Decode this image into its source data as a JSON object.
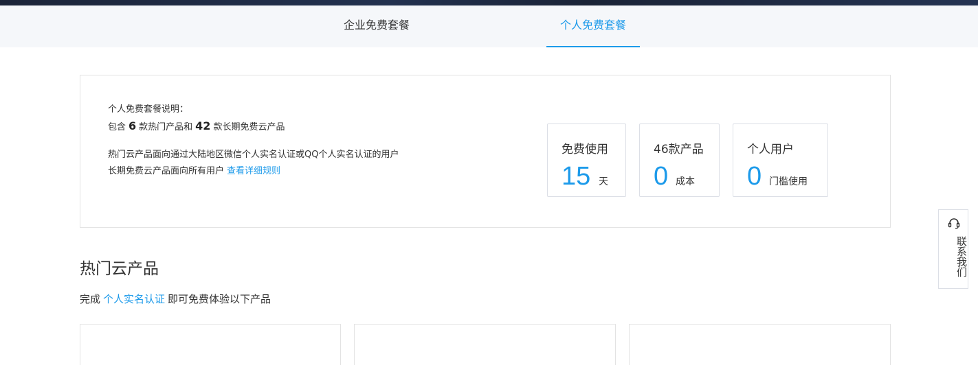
{
  "tabs": [
    {
      "label": "企业免费套餐",
      "active": false
    },
    {
      "label": "个人免费套餐",
      "active": true
    }
  ],
  "info": {
    "title": "个人免费套餐说明：",
    "include_prefix": "包含",
    "hot_count": "6",
    "include_mid": "款热门产品和",
    "long_count": "42",
    "include_suffix": "款长期免费云产品",
    "hot_desc": "热门云产品面向通过大陆地区微信个人实名认证或QQ个人实名认证的用户",
    "long_desc": "长期免费云产品面向所有用户",
    "rules_link": "查看详细规则"
  },
  "stats": [
    {
      "title": "免费使用",
      "value": "15",
      "unit": "天"
    },
    {
      "title": "46款产品",
      "value": "0",
      "unit": "成本"
    },
    {
      "title": "个人用户",
      "value": "0",
      "unit": "门槛使用"
    }
  ],
  "section": {
    "title": "热门云产品",
    "sub_prefix": "完成",
    "sub_link": "个人实名认证",
    "sub_suffix": "即可免费体验以下产品"
  },
  "contact": {
    "label": "联系我们",
    "icon": "headset-icon"
  },
  "colors": {
    "accent": "#1c9aea",
    "tabbar_bg": "#f5f7fa",
    "border": "#e3e3e3"
  }
}
